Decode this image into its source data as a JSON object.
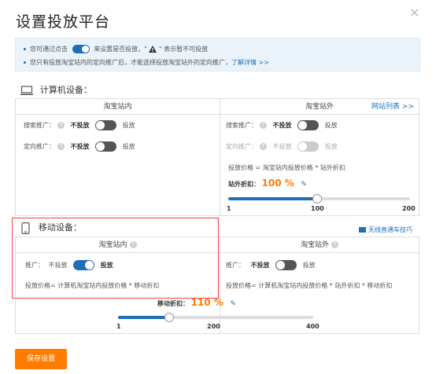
{
  "dialog": {
    "title": "设置投放平台",
    "close_icon": "×"
  },
  "notice": {
    "line1_pre": "您可通过点击",
    "line1_mid": "来设置是否投放，\"",
    "line1_post": "\" 表示暂不可投放",
    "line2_pre": "您只有投放淘宝站内的定向推广后，才能选择投放淘宝站外的定向推广，",
    "line2_link": "了解详情 >>"
  },
  "computer": {
    "section_title": "计算机设备：",
    "inside": {
      "header": "淘宝站内",
      "search": {
        "label": "搜索推广：",
        "off": "不投放",
        "on": "投放"
      },
      "target": {
        "label": "定向推广：",
        "off": "不投放",
        "on": "投放"
      }
    },
    "outside": {
      "header": "淘宝站外",
      "site_list_link": "网站列表 >>",
      "search": {
        "label": "搜索推广：",
        "off": "不投放",
        "on": "投放"
      },
      "target": {
        "label": "定向推广：",
        "off": "不投放",
        "on": "投放"
      },
      "price_formula": "投放价格 = 淘宝站内投放价格 * 站外折扣",
      "discount_label": "站外折扣：",
      "discount_value": "100 %",
      "slider": {
        "min": "1",
        "mid": "100",
        "max": "200",
        "value": 100,
        "min_val": 1,
        "max_val": 200
      }
    }
  },
  "mobile": {
    "section_title": "移动设备：",
    "tips_link": "无线直通车技巧",
    "inside": {
      "header": "淘宝站内",
      "promo": {
        "label": "推广：",
        "off": "不投放",
        "on": "投放"
      },
      "price_formula": "投放价格= 计算机淘宝站内投放价格 * 移动折扣"
    },
    "outside": {
      "header": "淘宝站外",
      "promo": {
        "label": "推广：",
        "off": "不投放",
        "on": "投放"
      },
      "price_formula": "投放价格= 计算机淘宝站内投放价格 * 站外折扣 * 移动折扣"
    },
    "discount_label": "移动折扣：",
    "discount_value": "110 %",
    "slider": {
      "min": "1",
      "mid": "200",
      "max": "400",
      "value": 110,
      "min_val": 1,
      "max_val": 400
    }
  },
  "footer": {
    "save_label": "保存设置"
  }
}
